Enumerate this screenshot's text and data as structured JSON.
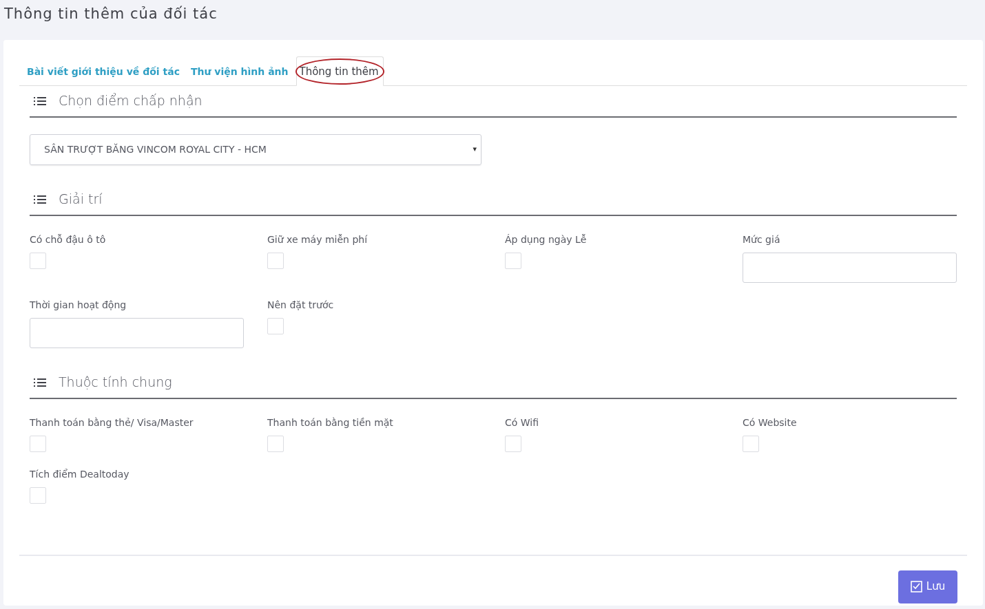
{
  "page_title": "Thông tin thêm của đối tác",
  "tabs": [
    {
      "label": "Bài viết giới thiệu về đối tác",
      "selected": false,
      "circled": false
    },
    {
      "label": "Thư viện hình ảnh",
      "selected": false,
      "circled": false
    },
    {
      "label": "Thông tin thêm",
      "selected": true,
      "circled": true
    }
  ],
  "sections": [
    {
      "title": "Chọn điểm chấp nhận",
      "fields": [
        {
          "kind": "select",
          "value": "SÂN TRƯỢT BĂNG VINCOM ROYAL CITY - HCM",
          "caret": "▾"
        }
      ]
    },
    {
      "title": "Giải trí",
      "fields": [
        {
          "kind": "checkbox",
          "label": "Có chỗ đậu ô tô",
          "checked": false
        },
        {
          "kind": "checkbox",
          "label": "Giữ xe máy miễn phí",
          "checked": false
        },
        {
          "kind": "checkbox",
          "label": "Áp dụng ngày Lễ",
          "checked": false
        },
        {
          "kind": "text",
          "label": "Mức giá"
        },
        {
          "kind": "text",
          "label": "Thời gian hoạt động"
        },
        {
          "kind": "checkbox",
          "label": "Nên đặt trước",
          "checked": false
        }
      ]
    },
    {
      "title": "Thuộc tính chung",
      "fields": [
        {
          "kind": "checkbox",
          "label": "Thanh toán bằng thẻ/ Visa/Master",
          "checked": false
        },
        {
          "kind": "checkbox",
          "label": "Thanh toán bằng tiền mặt",
          "checked": false
        },
        {
          "kind": "checkbox",
          "label": "Có Wifi",
          "checked": false
        },
        {
          "kind": "checkbox",
          "label": "Có Website",
          "checked": false
        },
        {
          "kind": "checkbox",
          "label": "Tích điểm Dealtoday",
          "checked": false
        }
      ]
    }
  ],
  "save_button": {
    "label": "Lưu"
  }
}
